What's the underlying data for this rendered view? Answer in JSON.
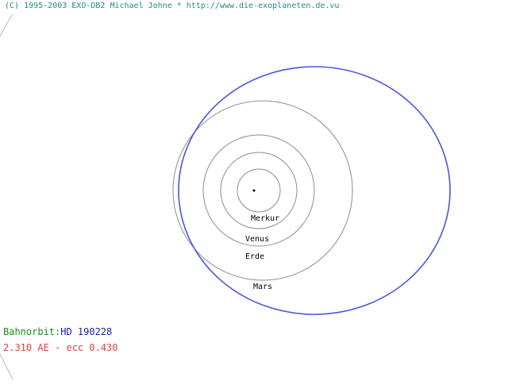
{
  "header": {
    "copyright": "(C) 1995-2003 EXO-DB2 Michael Johne * http://www.die-exoplaneten.de.vu"
  },
  "planets": [
    {
      "name": "Merkur"
    },
    {
      "name": "Venus"
    },
    {
      "name": "Erde"
    },
    {
      "name": "Mars"
    }
  ],
  "info": {
    "orbit_label": "Bahnorbit:",
    "planet_name": "HD 190228",
    "orbit_params": "2.310 AE - ecc 0.430"
  },
  "colors": {
    "copyright": "#1a8c8c",
    "orbit_label": "#1a8c1a",
    "planet_name": "#1a1a9c",
    "orbit_params": "#e04040",
    "exo_orbit": "#4a55e0",
    "planet_orbits": "#8c8c8c"
  }
}
